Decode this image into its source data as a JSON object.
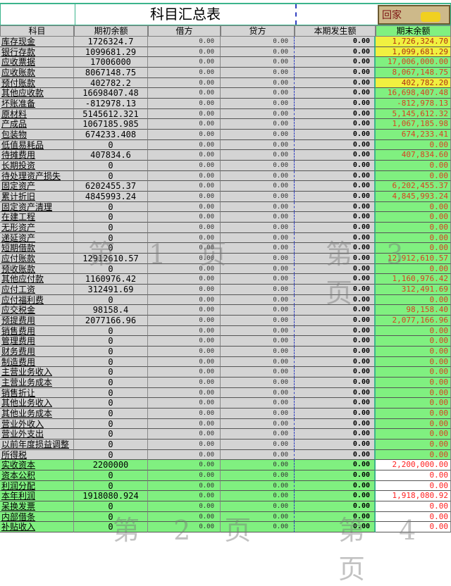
{
  "title": "科目汇总表",
  "logo_text": "回家",
  "headers": [
    "科目",
    "期初余额",
    "借方",
    "贷方",
    "本期发生额",
    "期末余额"
  ],
  "zero": "0.00",
  "watermarks": [
    "第 1 页",
    "第 3 页",
    "第 2 页",
    "第 4 页"
  ],
  "rows": [
    {
      "name": "库存现金",
      "opening": "1726324.7",
      "ending": "1,726,324.70",
      "style": "yellow",
      "group": "gray"
    },
    {
      "name": "银行存款",
      "opening": "1099681.29",
      "ending": "1,099,681.29",
      "style": "yellow",
      "group": "gray"
    },
    {
      "name": "应收票据",
      "opening": "17006000",
      "ending": "17,006,000.00",
      "style": "green",
      "group": "gray"
    },
    {
      "name": "应收账款",
      "opening": "8067148.75",
      "ending": "8,067,148.75",
      "style": "green",
      "group": "gray"
    },
    {
      "name": "预付账款",
      "opening": "402782.2",
      "ending": "402,782.20",
      "style": "yellow",
      "group": "gray"
    },
    {
      "name": "其他应收款",
      "opening": "16698407.48",
      "ending": "16,698,407.48",
      "style": "green",
      "group": "gray"
    },
    {
      "name": "坏账准备",
      "opening": "-812978.13",
      "ending": "-812,978.13",
      "style": "green",
      "group": "gray"
    },
    {
      "name": "原材料",
      "opening": "5145612.321",
      "ending": "5,145,612.32",
      "style": "green",
      "group": "gray"
    },
    {
      "name": "产成品",
      "opening": "1067185.985",
      "ending": "1,067,185.98",
      "style": "green",
      "group": "gray"
    },
    {
      "name": "包装物",
      "opening": "674233.408",
      "ending": "674,233.41",
      "style": "green",
      "group": "gray"
    },
    {
      "name": "低值易耗品",
      "opening": "0",
      "ending": "0.00",
      "style": "green",
      "group": "gray"
    },
    {
      "name": "待摊费用",
      "opening": "407834.6",
      "ending": "407,834.60",
      "style": "green",
      "group": "gray"
    },
    {
      "name": "长期投资",
      "opening": "0",
      "ending": "0.00",
      "style": "green",
      "group": "gray"
    },
    {
      "name": "待处理资产损失",
      "opening": "0",
      "ending": "0.00",
      "style": "green",
      "group": "gray"
    },
    {
      "name": "固定资产",
      "opening": "6202455.37",
      "ending": "6,202,455.37",
      "style": "green",
      "group": "gray"
    },
    {
      "name": "累计折旧",
      "opening": "4845993.24",
      "ending": "4,845,993.24",
      "style": "green",
      "group": "gray"
    },
    {
      "name": "固定资产清理",
      "opening": "0",
      "ending": "0.00",
      "style": "green",
      "group": "gray"
    },
    {
      "name": "在建工程",
      "opening": "0",
      "ending": "0.00",
      "style": "green",
      "group": "gray"
    },
    {
      "name": "无形资产",
      "opening": "0",
      "ending": "0.00",
      "style": "green",
      "group": "gray"
    },
    {
      "name": "递延资产",
      "opening": "0",
      "ending": "0.00",
      "style": "green",
      "group": "gray"
    },
    {
      "name": "短期借款",
      "opening": "0",
      "ending": "0.00",
      "style": "green",
      "group": "gray"
    },
    {
      "name": "应付账款",
      "opening": "12912610.57",
      "ending": "12,912,610.57",
      "style": "green",
      "group": "gray"
    },
    {
      "name": "预收账款",
      "opening": "0",
      "ending": "0.00",
      "style": "green",
      "group": "gray"
    },
    {
      "name": "其他应付款",
      "opening": "1160976.42",
      "ending": "1,160,976.42",
      "style": "green",
      "group": "gray"
    },
    {
      "name": "应付工资",
      "opening": "312491.69",
      "ending": "312,491.69",
      "style": "green",
      "group": "gray"
    },
    {
      "name": "应付福利费",
      "opening": "0",
      "ending": "0.00",
      "style": "green",
      "group": "gray"
    },
    {
      "name": "应交税金",
      "opening": "98158.4",
      "ending": "98,158.40",
      "style": "green",
      "group": "gray"
    },
    {
      "name": "预提费用",
      "opening": "2077166.96",
      "ending": "2,077,166.96",
      "style": "green",
      "group": "gray"
    },
    {
      "name": "销售费用",
      "opening": "0",
      "ending": "0.00",
      "style": "green",
      "group": "gray"
    },
    {
      "name": "管理费用",
      "opening": "0",
      "ending": "0.00",
      "style": "green",
      "group": "gray"
    },
    {
      "name": "财务费用",
      "opening": "0",
      "ending": "0.00",
      "style": "green",
      "group": "gray"
    },
    {
      "name": "制造费用",
      "opening": "0",
      "ending": "0.00",
      "style": "green",
      "group": "gray"
    },
    {
      "name": "主营业务收入",
      "opening": "0",
      "ending": "0.00",
      "style": "green",
      "group": "gray"
    },
    {
      "name": "主营业务成本",
      "opening": "0",
      "ending": "0.00",
      "style": "green",
      "group": "gray"
    },
    {
      "name": "销售折让",
      "opening": "0",
      "ending": "0.00",
      "style": "green",
      "group": "gray"
    },
    {
      "name": "其他业务收入",
      "opening": "0",
      "ending": "0.00",
      "style": "green",
      "group": "gray"
    },
    {
      "name": "其他业务成本",
      "opening": "0",
      "ending": "0.00",
      "style": "green",
      "group": "gray"
    },
    {
      "name": "营业外收入",
      "opening": "0",
      "ending": "0.00",
      "style": "green",
      "group": "gray"
    },
    {
      "name": "营业外支出",
      "opening": "0",
      "ending": "0.00",
      "style": "green",
      "group": "gray"
    },
    {
      "name": "以前年度损益调整",
      "opening": "0",
      "ending": "0.00",
      "style": "green",
      "group": "gray"
    },
    {
      "name": "所得税",
      "opening": "0",
      "ending": "0.00",
      "style": "green",
      "group": "gray"
    },
    {
      "name": "实收资本",
      "opening": "2200000",
      "ending": "2,200,000.00",
      "style": "white",
      "group": "green"
    },
    {
      "name": "资本公积",
      "opening": "0",
      "ending": "0.00",
      "style": "white",
      "group": "green"
    },
    {
      "name": "利润分配",
      "opening": "0",
      "ending": "0.00",
      "style": "white",
      "group": "green"
    },
    {
      "name": "本年利润",
      "opening": "1918080.924",
      "ending": "1,918,080.92",
      "style": "white",
      "group": "green"
    },
    {
      "name": "呆换发票",
      "opening": "0",
      "ending": "0.00",
      "style": "white",
      "group": "green"
    },
    {
      "name": "内部借条",
      "opening": "0",
      "ending": "0.00",
      "style": "white",
      "group": "green"
    },
    {
      "name": "补贴收入",
      "opening": "0",
      "ending": "0.00",
      "style": "white",
      "group": "green"
    }
  ]
}
